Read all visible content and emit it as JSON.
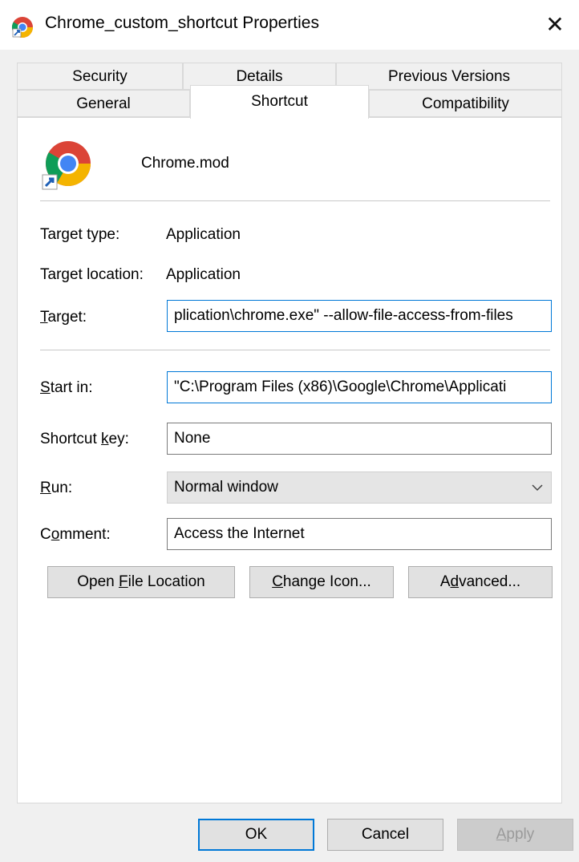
{
  "window": {
    "title": "Chrome_custom_shortcut Properties",
    "close_glyph": "✕"
  },
  "tabs": {
    "row1": [
      "Security",
      "Details",
      "Previous Versions"
    ],
    "row2": [
      "General",
      "Shortcut",
      "Compatibility"
    ],
    "active": "Shortcut"
  },
  "shortcut": {
    "name": "Chrome.mod",
    "target_type_label": "Target type:",
    "target_type": "Application",
    "target_location_label": "Target location:",
    "target_location": "Application",
    "target_label_pre": "",
    "target_label_ul": "T",
    "target_label_post": "arget:",
    "target_value": "plication\\chrome.exe\" --allow-file-access-from-files",
    "start_in_label_ul": "S",
    "start_in_label_post": "tart in:",
    "start_in_value": "\"C:\\Program Files (x86)\\Google\\Chrome\\Applicati",
    "shortcut_key_label_pre": "Shortcut ",
    "shortcut_key_label_ul": "k",
    "shortcut_key_label_post": "ey:",
    "shortcut_key_value": "None",
    "run_label_ul": "R",
    "run_label_post": "un:",
    "run_value": "Normal window",
    "comment_label_pre": "C",
    "comment_label_ul": "o",
    "comment_label_post": "mment:",
    "comment_value": "Access the Internet"
  },
  "buttons": {
    "open_file_pre": "Open ",
    "open_file_ul": "F",
    "open_file_post": "ile Location",
    "change_icon_ul": "C",
    "change_icon_post": "hange Icon...",
    "advanced_pre": "A",
    "advanced_ul": "d",
    "advanced_post": "vanced...",
    "ok": "OK",
    "cancel": "Cancel",
    "apply_ul": "A",
    "apply_post": "pply"
  }
}
